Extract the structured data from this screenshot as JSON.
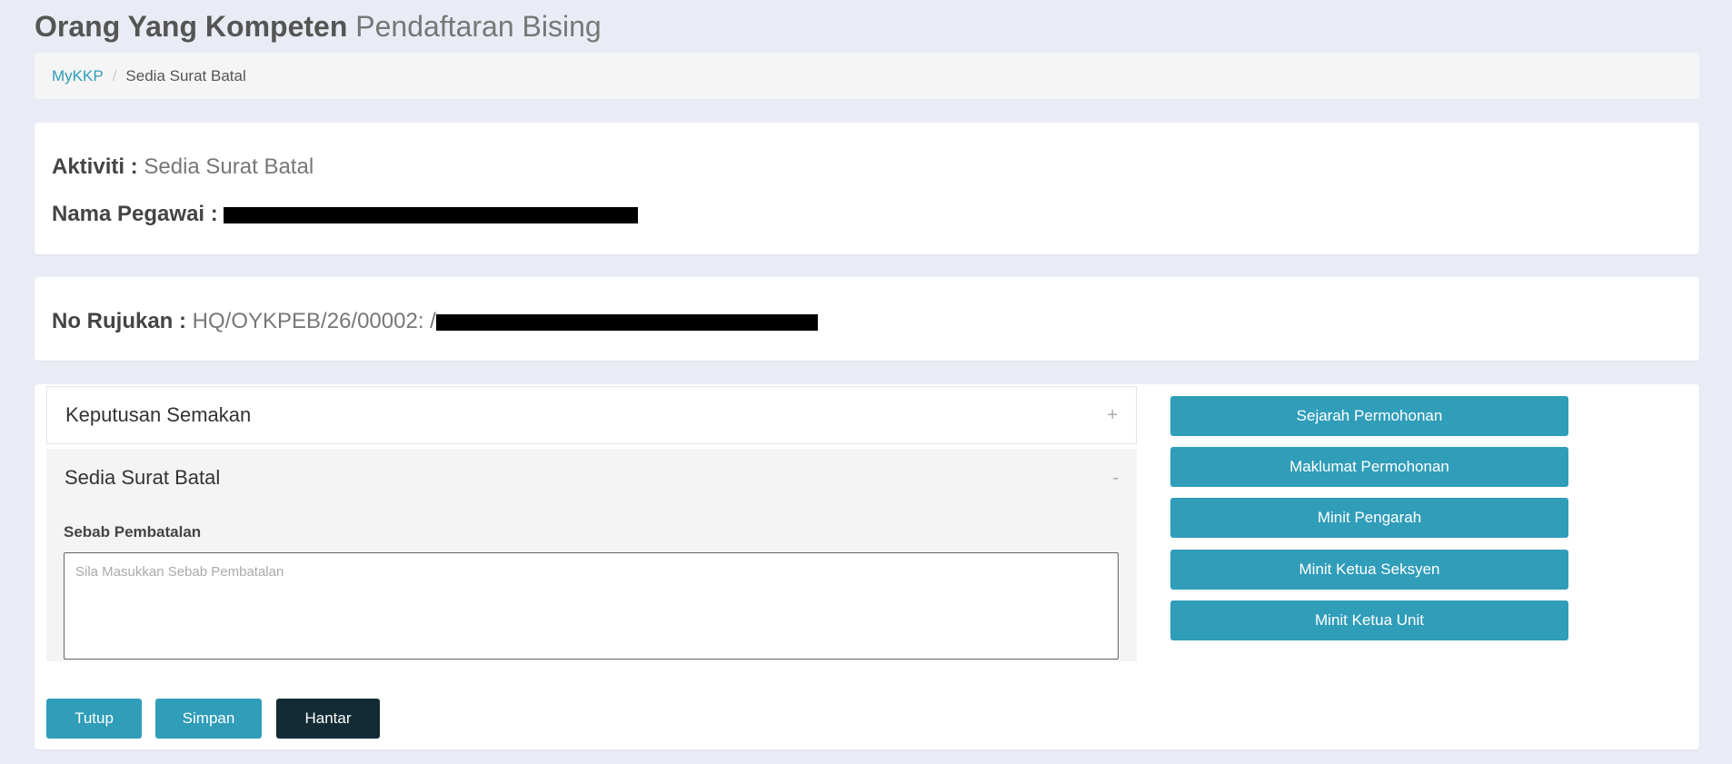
{
  "header": {
    "title_strong": "Orang Yang Kompeten",
    "title_light": "Pendaftaran Bising"
  },
  "breadcrumb": {
    "home": "MyKKP",
    "separator": "/",
    "current": "Sedia Surat Batal"
  },
  "activity": {
    "aktiviti_label": "Aktiviti :",
    "aktiviti_value": "Sedia Surat Batal",
    "pegawai_label": "Nama Pegawai :"
  },
  "reference": {
    "label": "No Rujukan :",
    "value": "HQ/OYKPEB/26/00002: /"
  },
  "accordion": {
    "item1_title": "Keputusan Semakan",
    "item1_toggle": "+",
    "item2_title": "Sedia Surat Batal",
    "item2_toggle": "-",
    "field_label": "Sebab Pembatalan",
    "field_placeholder": "Sila Masukkan Sebab Pembatalan",
    "field_value": ""
  },
  "side_buttons": [
    "Sejarah Permohonan",
    "Maklumat Permohonan",
    "Minit Pengarah",
    "Minit Ketua Seksyen",
    "Minit Ketua Unit"
  ],
  "footer_buttons": {
    "close": "Tutup",
    "save": "Simpan",
    "submit": "Hantar"
  },
  "colors": {
    "background": "#e9ecf5",
    "accent": "#309db9",
    "dark_button": "#122b35",
    "link": "#2f9bb8"
  }
}
